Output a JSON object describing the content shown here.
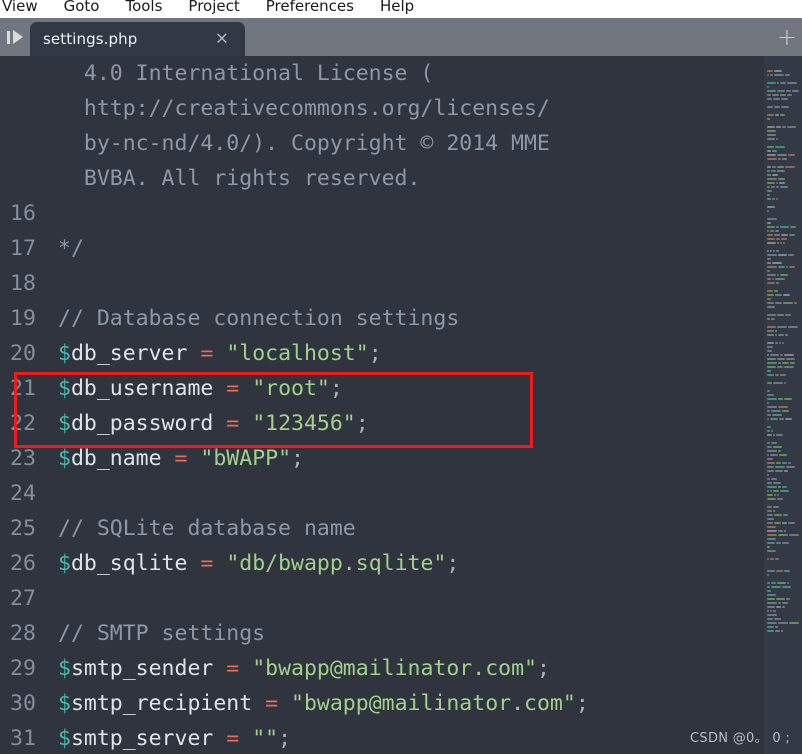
{
  "menubar": {
    "items": [
      {
        "label": "View"
      },
      {
        "label": "Goto"
      },
      {
        "label": "Tools"
      },
      {
        "label": "Project"
      },
      {
        "label": "Preferences"
      },
      {
        "label": "Help"
      }
    ]
  },
  "tabbar": {
    "run_icon": "run-play-icon",
    "active_tab": {
      "label": "settings.php",
      "close_label": "×"
    },
    "new_tab_label": "+"
  },
  "editor": {
    "filename": "settings.php",
    "language": "php",
    "first_visible_line": 12,
    "lines": [
      {
        "number": "",
        "tokens": [
          {
            "t": "comment",
            "s": "  4.0 International License ("
          }
        ]
      },
      {
        "number": "",
        "tokens": [
          {
            "t": "comment",
            "s": "  http://creativecommons.org/licenses/"
          }
        ]
      },
      {
        "number": "",
        "tokens": [
          {
            "t": "comment",
            "s": "  by-nc-nd/4.0/). Copyright © 2014 MME"
          }
        ]
      },
      {
        "number": "",
        "tokens": [
          {
            "t": "comment",
            "s": "  BVBA. All rights reserved."
          }
        ]
      },
      {
        "number": "16",
        "tokens": [
          {
            "t": "comment",
            "s": ""
          }
        ]
      },
      {
        "number": "17",
        "tokens": [
          {
            "t": "comment",
            "s": "*/"
          }
        ]
      },
      {
        "number": "18",
        "tokens": [
          {
            "t": "plain",
            "s": ""
          }
        ]
      },
      {
        "number": "19",
        "tokens": [
          {
            "t": "comment",
            "s": "// Database connection settings"
          }
        ]
      },
      {
        "number": "20",
        "tokens": [
          {
            "t": "sigil",
            "s": "$"
          },
          {
            "t": "var",
            "s": "db_server "
          },
          {
            "t": "op",
            "s": "="
          },
          {
            "t": "var",
            "s": " "
          },
          {
            "t": "str",
            "s": "\"localhost\""
          },
          {
            "t": "punc",
            "s": ";"
          }
        ]
      },
      {
        "number": "21",
        "tokens": [
          {
            "t": "sigil",
            "s": "$"
          },
          {
            "t": "var",
            "s": "db_username "
          },
          {
            "t": "op",
            "s": "="
          },
          {
            "t": "var",
            "s": " "
          },
          {
            "t": "str",
            "s": "\"root\""
          },
          {
            "t": "punc",
            "s": ";"
          }
        ]
      },
      {
        "number": "22",
        "tokens": [
          {
            "t": "sigil",
            "s": "$"
          },
          {
            "t": "var",
            "s": "db_password "
          },
          {
            "t": "op",
            "s": "="
          },
          {
            "t": "var",
            "s": " "
          },
          {
            "t": "str",
            "s": "\"123456\""
          },
          {
            "t": "punc",
            "s": ";"
          }
        ]
      },
      {
        "number": "23",
        "tokens": [
          {
            "t": "sigil",
            "s": "$"
          },
          {
            "t": "var",
            "s": "db_name "
          },
          {
            "t": "op",
            "s": "="
          },
          {
            "t": "var",
            "s": " "
          },
          {
            "t": "str",
            "s": "\"bWAPP\""
          },
          {
            "t": "punc",
            "s": ";"
          }
        ]
      },
      {
        "number": "24",
        "tokens": [
          {
            "t": "plain",
            "s": ""
          }
        ]
      },
      {
        "number": "25",
        "tokens": [
          {
            "t": "comment",
            "s": "// SQLite database name"
          }
        ]
      },
      {
        "number": "26",
        "tokens": [
          {
            "t": "sigil",
            "s": "$"
          },
          {
            "t": "var",
            "s": "db_sqlite "
          },
          {
            "t": "op",
            "s": "="
          },
          {
            "t": "var",
            "s": " "
          },
          {
            "t": "str",
            "s": "\"db/bwapp.sqlite\""
          },
          {
            "t": "punc",
            "s": ";"
          }
        ]
      },
      {
        "number": "27",
        "tokens": [
          {
            "t": "plain",
            "s": ""
          }
        ]
      },
      {
        "number": "28",
        "tokens": [
          {
            "t": "comment",
            "s": "// SMTP settings"
          }
        ]
      },
      {
        "number": "29",
        "tokens": [
          {
            "t": "sigil",
            "s": "$"
          },
          {
            "t": "var",
            "s": "smtp_sender "
          },
          {
            "t": "op",
            "s": "="
          },
          {
            "t": "var",
            "s": " "
          },
          {
            "t": "str",
            "s": "\"bwapp@mailinator.com\""
          },
          {
            "t": "punc",
            "s": ";"
          }
        ]
      },
      {
        "number": "30",
        "tokens": [
          {
            "t": "sigil",
            "s": "$"
          },
          {
            "t": "var",
            "s": "smtp_recipient "
          },
          {
            "t": "op",
            "s": "="
          },
          {
            "t": "var",
            "s": " "
          },
          {
            "t": "str",
            "s": "\"bwapp@mailinator.com\""
          },
          {
            "t": "punc",
            "s": ";"
          }
        ]
      },
      {
        "number": "31",
        "tokens": [
          {
            "t": "sigil",
            "s": "$"
          },
          {
            "t": "var",
            "s": "smtp_server "
          },
          {
            "t": "op",
            "s": "="
          },
          {
            "t": "var",
            "s": " "
          },
          {
            "t": "str",
            "s": "\"\""
          },
          {
            "t": "punc",
            "s": ";"
          }
        ]
      }
    ],
    "annotation": {
      "type": "red-rectangle-highlight",
      "covers_lines": "21-22",
      "color": "#f01c1c"
    }
  },
  "watermark": {
    "text": "CSDN @0。 0 ;"
  },
  "colors": {
    "editor_background": "#2f343f",
    "tabbar_background": "#72777f",
    "tab_active_background": "#333944",
    "menubar_background": "#ffffff",
    "gutter_text": "#878e9a",
    "comment": "#8f98a6",
    "variable_sigil": "#49b8ae",
    "variable_name": "#dfe3ea",
    "operator": "#ef6b52",
    "string": "#a3d08a",
    "annotation_red": "#f01c1c",
    "minimap_background": "#333945"
  }
}
